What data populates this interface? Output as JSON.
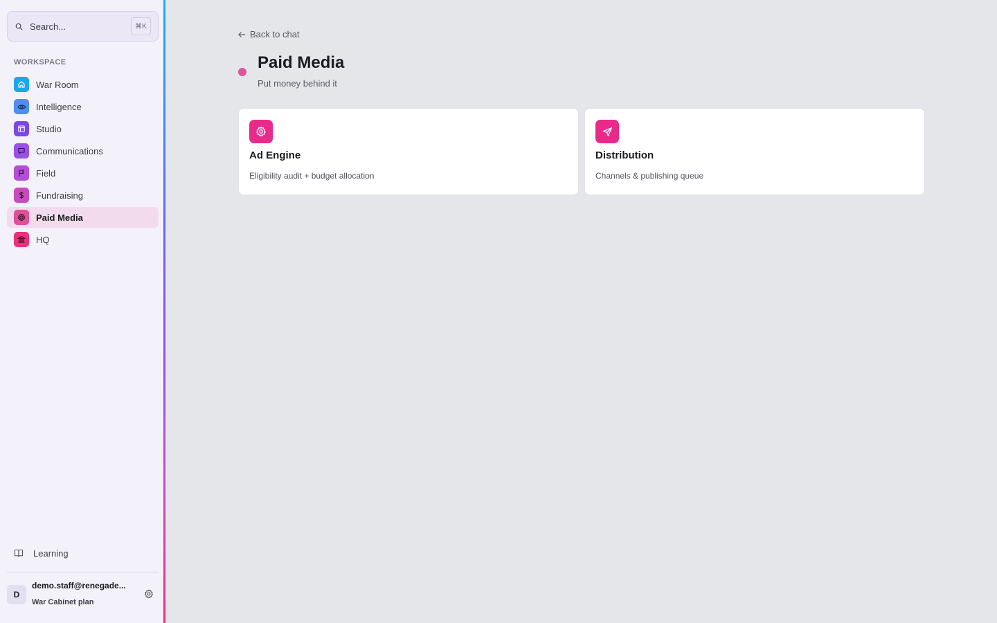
{
  "search": {
    "placeholder": "Search...",
    "shortcut": "⌘K"
  },
  "sidebar": {
    "section_label": "WORKSPACE",
    "items": [
      {
        "label": "War Room",
        "icon": "home-icon",
        "color": "#1aa7ec"
      },
      {
        "label": "Intelligence",
        "icon": "eye-icon",
        "color": "#4d8ff0"
      },
      {
        "label": "Studio",
        "icon": "layout-icon",
        "color": "#7a48e8"
      },
      {
        "label": "Communications",
        "icon": "message-icon",
        "color": "#9a4fe6"
      },
      {
        "label": "Field",
        "icon": "flag-icon",
        "color": "#b34fd6"
      },
      {
        "label": "Fundraising",
        "icon": "dollar-icon",
        "color": "#c84bbd"
      },
      {
        "label": "Paid Media",
        "icon": "target-icon",
        "color": "#df4f9a",
        "active": true
      },
      {
        "label": "HQ",
        "icon": "bank-icon",
        "color": "#ec2f7c"
      }
    ],
    "learning": {
      "label": "Learning",
      "icon": "book-icon"
    }
  },
  "user": {
    "initial": "D",
    "email": "demo.staff@renegade...",
    "plan": "War Cabinet plan"
  },
  "main": {
    "back_label": "Back to chat",
    "title": "Paid Media",
    "subtitle": "Put money behind it",
    "accent": "#e05597",
    "cards": [
      {
        "title": "Ad Engine",
        "description": "Eligibility audit + budget allocation",
        "icon": "gear-icon"
      },
      {
        "title": "Distribution",
        "description": "Channels & publishing queue",
        "icon": "send-icon"
      }
    ]
  }
}
